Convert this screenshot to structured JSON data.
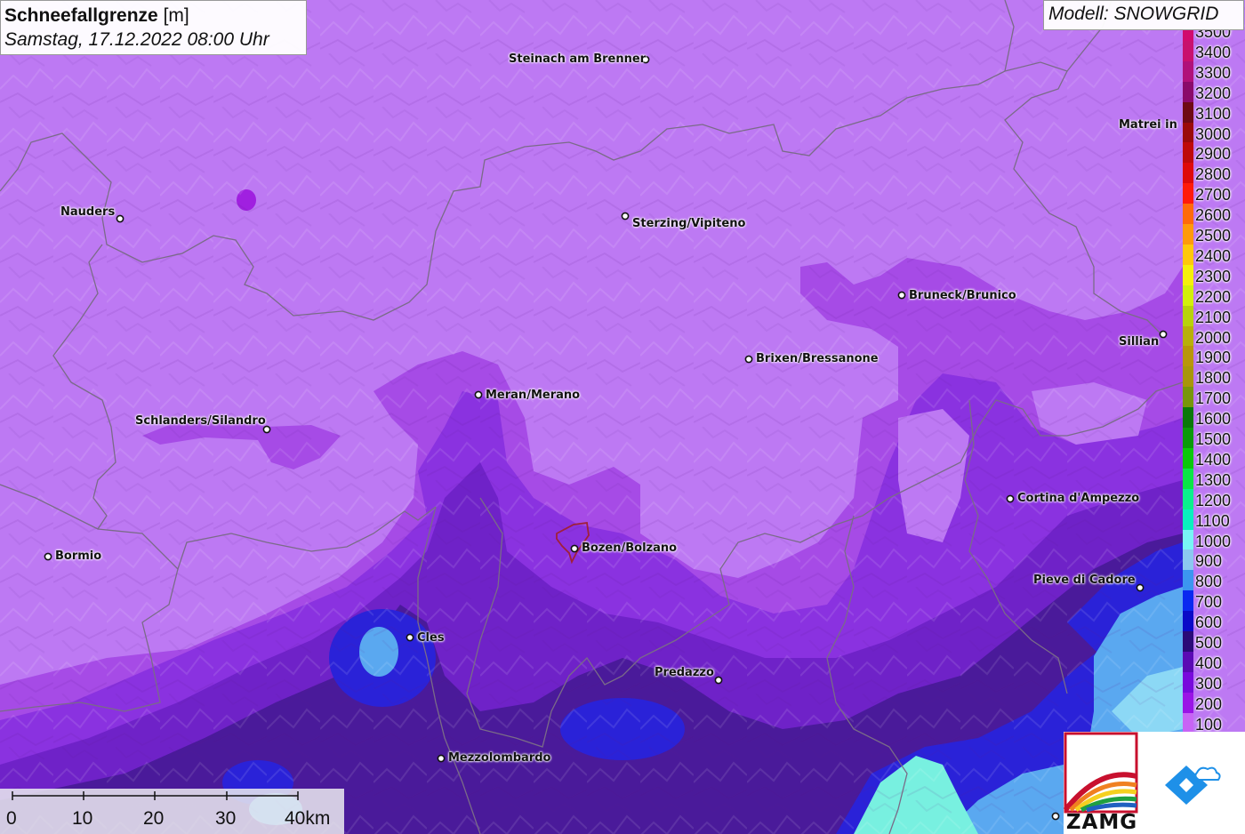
{
  "title": {
    "variable": "Schneefallgrenze",
    "unit": "[m]",
    "datetime": "Samstag, 17.12.2022 08:00 Uhr"
  },
  "model_label": "Modell: SNOWGRID",
  "cities": [
    {
      "name": "Steinach am Brenner"
    },
    {
      "name": "Nauders"
    },
    {
      "name": "Sterzing/Vipiteno"
    },
    {
      "name": "Matrei in Osttirol"
    },
    {
      "name": "Bruneck/Brunico"
    },
    {
      "name": "Sillian"
    },
    {
      "name": "Brixen/Bressanone"
    },
    {
      "name": "Meran/Merano"
    },
    {
      "name": "Schlanders/Silandro"
    },
    {
      "name": "Cortina d'Ampezzo"
    },
    {
      "name": "Bormio"
    },
    {
      "name": "Bozen/Bolzano"
    },
    {
      "name": "Pieve di Cadore"
    },
    {
      "name": "Cles"
    },
    {
      "name": "Predazzo"
    },
    {
      "name": "Mezzolombardo"
    }
  ],
  "legend": {
    "items": [
      {
        "label": "3500",
        "color": "#d10a6e"
      },
      {
        "label": "3400",
        "color": "#c8106e"
      },
      {
        "label": "3300",
        "color": "#b0107a"
      },
      {
        "label": "3200",
        "color": "#8a0a6a"
      },
      {
        "label": "3100",
        "color": "#6e0a14"
      },
      {
        "label": "3000",
        "color": "#9a0a0a"
      },
      {
        "label": "2900",
        "color": "#be0a0a"
      },
      {
        "label": "2800",
        "color": "#de0a0a"
      },
      {
        "label": "2700",
        "color": "#ff1a0a"
      },
      {
        "label": "2600",
        "color": "#ff6a0a"
      },
      {
        "label": "2500",
        "color": "#ff9a0a"
      },
      {
        "label": "2400",
        "color": "#ffc80a"
      },
      {
        "label": "2300",
        "color": "#f5f00a"
      },
      {
        "label": "2200",
        "color": "#d2f00a"
      },
      {
        "label": "2100",
        "color": "#b8d20a"
      },
      {
        "label": "2000",
        "color": "#b8b00a"
      },
      {
        "label": "1900",
        "color": "#b8960a"
      },
      {
        "label": "1800",
        "color": "#a8960a"
      },
      {
        "label": "1700",
        "color": "#78960a"
      },
      {
        "label": "1600",
        "color": "#0a780a"
      },
      {
        "label": "1500",
        "color": "#0a9a0a"
      },
      {
        "label": "1400",
        "color": "#0ac80a"
      },
      {
        "label": "1300",
        "color": "#0ae646"
      },
      {
        "label": "1200",
        "color": "#0af08c"
      },
      {
        "label": "1100",
        "color": "#0af0be"
      },
      {
        "label": "1000",
        "color": "#78f5f5"
      },
      {
        "label": "900",
        "color": "#8cc8f0"
      },
      {
        "label": "800",
        "color": "#3c96f0"
      },
      {
        "label": "700",
        "color": "#0a28f0"
      },
      {
        "label": "600",
        "color": "#0a0ac8"
      },
      {
        "label": "500",
        "color": "#2a0a78"
      },
      {
        "label": "400",
        "color": "#5a0ab4"
      },
      {
        "label": "300",
        "color": "#780adc"
      },
      {
        "label": "200",
        "color": "#9a14e6"
      },
      {
        "label": "100",
        "color": "#c864f5"
      }
    ]
  },
  "scale_bar": {
    "labels": [
      "0",
      "10",
      "20",
      "30",
      "40km"
    ]
  },
  "logos": {
    "zamg_text": "ZAMG"
  }
}
